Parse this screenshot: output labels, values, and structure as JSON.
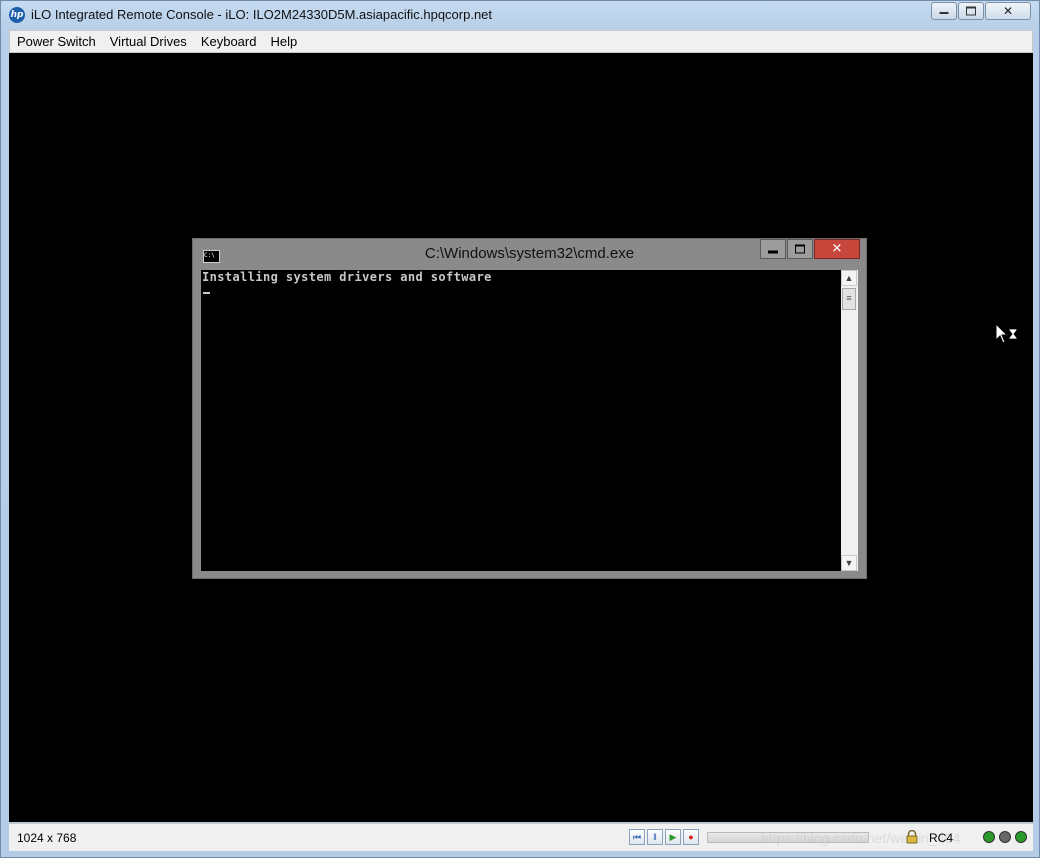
{
  "window": {
    "title": "iLO Integrated Remote Console - iLO: ILO2M24330D5M.asiapacific.hpqcorp.net",
    "logo_text": "hp"
  },
  "menu": {
    "items": [
      "Power Switch",
      "Virtual Drives",
      "Keyboard",
      "Help"
    ]
  },
  "cmd": {
    "title": "C:\\Windows\\system32\\cmd.exe",
    "icon_text": "C:\\",
    "output_line": "Installing system drivers and software"
  },
  "status": {
    "resolution": "1024 x 768",
    "encryption": "RC4",
    "watermark": "https://blog.csdn.net/weixin_404"
  },
  "icons": {
    "title_buttons": [
      "minimize-icon",
      "restore-icon",
      "close-icon"
    ],
    "playback": [
      "skip-back-icon",
      "pause-icon",
      "play-icon",
      "record-icon"
    ],
    "status": [
      "lock-icon",
      "health-icon",
      "power-icon",
      "connection-icon"
    ]
  },
  "colors": {
    "screen": "#000000",
    "cmd_close": "#c8473c",
    "record": "#d42020",
    "play": "#2a9a2a"
  }
}
